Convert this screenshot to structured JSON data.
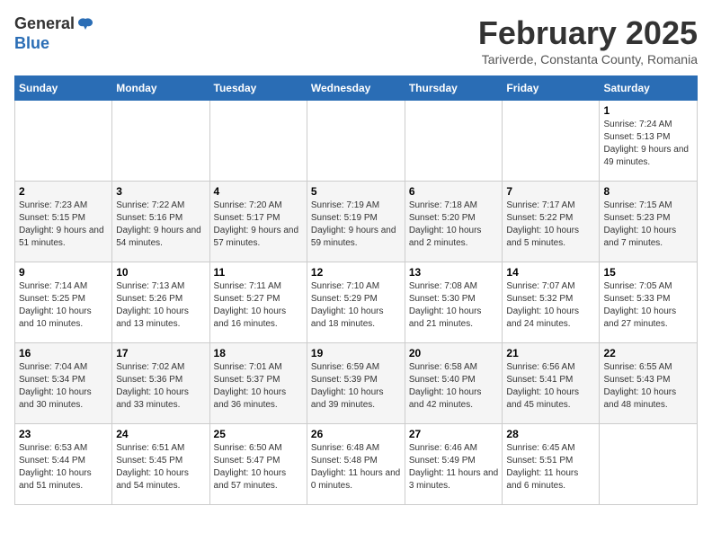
{
  "header": {
    "logo_general": "General",
    "logo_blue": "Blue",
    "month_title": "February 2025",
    "location": "Tariverde, Constanta County, Romania"
  },
  "days_of_week": [
    "Sunday",
    "Monday",
    "Tuesday",
    "Wednesday",
    "Thursday",
    "Friday",
    "Saturday"
  ],
  "weeks": [
    [
      {
        "day": "",
        "info": ""
      },
      {
        "day": "",
        "info": ""
      },
      {
        "day": "",
        "info": ""
      },
      {
        "day": "",
        "info": ""
      },
      {
        "day": "",
        "info": ""
      },
      {
        "day": "",
        "info": ""
      },
      {
        "day": "1",
        "info": "Sunrise: 7:24 AM\nSunset: 5:13 PM\nDaylight: 9 hours and 49 minutes."
      }
    ],
    [
      {
        "day": "2",
        "info": "Sunrise: 7:23 AM\nSunset: 5:15 PM\nDaylight: 9 hours and 51 minutes."
      },
      {
        "day": "3",
        "info": "Sunrise: 7:22 AM\nSunset: 5:16 PM\nDaylight: 9 hours and 54 minutes."
      },
      {
        "day": "4",
        "info": "Sunrise: 7:20 AM\nSunset: 5:17 PM\nDaylight: 9 hours and 57 minutes."
      },
      {
        "day": "5",
        "info": "Sunrise: 7:19 AM\nSunset: 5:19 PM\nDaylight: 9 hours and 59 minutes."
      },
      {
        "day": "6",
        "info": "Sunrise: 7:18 AM\nSunset: 5:20 PM\nDaylight: 10 hours and 2 minutes."
      },
      {
        "day": "7",
        "info": "Sunrise: 7:17 AM\nSunset: 5:22 PM\nDaylight: 10 hours and 5 minutes."
      },
      {
        "day": "8",
        "info": "Sunrise: 7:15 AM\nSunset: 5:23 PM\nDaylight: 10 hours and 7 minutes."
      }
    ],
    [
      {
        "day": "9",
        "info": "Sunrise: 7:14 AM\nSunset: 5:25 PM\nDaylight: 10 hours and 10 minutes."
      },
      {
        "day": "10",
        "info": "Sunrise: 7:13 AM\nSunset: 5:26 PM\nDaylight: 10 hours and 13 minutes."
      },
      {
        "day": "11",
        "info": "Sunrise: 7:11 AM\nSunset: 5:27 PM\nDaylight: 10 hours and 16 minutes."
      },
      {
        "day": "12",
        "info": "Sunrise: 7:10 AM\nSunset: 5:29 PM\nDaylight: 10 hours and 18 minutes."
      },
      {
        "day": "13",
        "info": "Sunrise: 7:08 AM\nSunset: 5:30 PM\nDaylight: 10 hours and 21 minutes."
      },
      {
        "day": "14",
        "info": "Sunrise: 7:07 AM\nSunset: 5:32 PM\nDaylight: 10 hours and 24 minutes."
      },
      {
        "day": "15",
        "info": "Sunrise: 7:05 AM\nSunset: 5:33 PM\nDaylight: 10 hours and 27 minutes."
      }
    ],
    [
      {
        "day": "16",
        "info": "Sunrise: 7:04 AM\nSunset: 5:34 PM\nDaylight: 10 hours and 30 minutes."
      },
      {
        "day": "17",
        "info": "Sunrise: 7:02 AM\nSunset: 5:36 PM\nDaylight: 10 hours and 33 minutes."
      },
      {
        "day": "18",
        "info": "Sunrise: 7:01 AM\nSunset: 5:37 PM\nDaylight: 10 hours and 36 minutes."
      },
      {
        "day": "19",
        "info": "Sunrise: 6:59 AM\nSunset: 5:39 PM\nDaylight: 10 hours and 39 minutes."
      },
      {
        "day": "20",
        "info": "Sunrise: 6:58 AM\nSunset: 5:40 PM\nDaylight: 10 hours and 42 minutes."
      },
      {
        "day": "21",
        "info": "Sunrise: 6:56 AM\nSunset: 5:41 PM\nDaylight: 10 hours and 45 minutes."
      },
      {
        "day": "22",
        "info": "Sunrise: 6:55 AM\nSunset: 5:43 PM\nDaylight: 10 hours and 48 minutes."
      }
    ],
    [
      {
        "day": "23",
        "info": "Sunrise: 6:53 AM\nSunset: 5:44 PM\nDaylight: 10 hours and 51 minutes."
      },
      {
        "day": "24",
        "info": "Sunrise: 6:51 AM\nSunset: 5:45 PM\nDaylight: 10 hours and 54 minutes."
      },
      {
        "day": "25",
        "info": "Sunrise: 6:50 AM\nSunset: 5:47 PM\nDaylight: 10 hours and 57 minutes."
      },
      {
        "day": "26",
        "info": "Sunrise: 6:48 AM\nSunset: 5:48 PM\nDaylight: 11 hours and 0 minutes."
      },
      {
        "day": "27",
        "info": "Sunrise: 6:46 AM\nSunset: 5:49 PM\nDaylight: 11 hours and 3 minutes."
      },
      {
        "day": "28",
        "info": "Sunrise: 6:45 AM\nSunset: 5:51 PM\nDaylight: 11 hours and 6 minutes."
      },
      {
        "day": "",
        "info": ""
      }
    ]
  ]
}
